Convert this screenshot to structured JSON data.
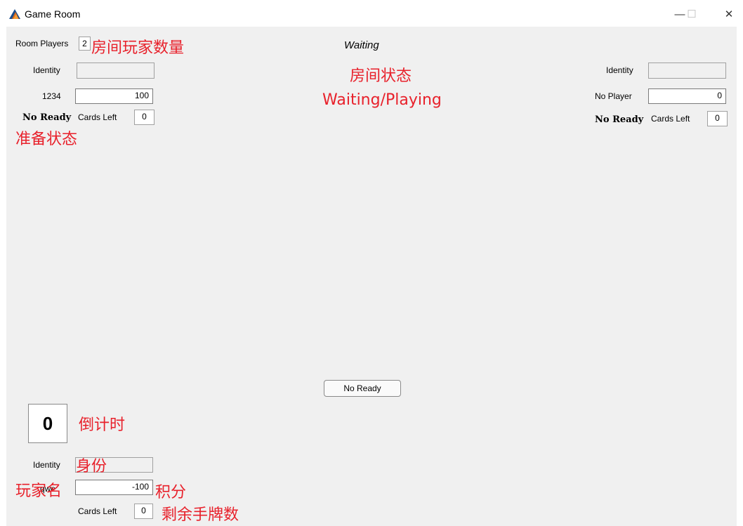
{
  "window": {
    "title": "Game Room",
    "icon": "matlab-icon",
    "controls": {
      "minimize": "—",
      "maximize": "☐",
      "close": "✕"
    }
  },
  "room": {
    "players_label": "Room Players",
    "players_value": "2",
    "status": "Waiting"
  },
  "left_player": {
    "identity_label": "Identity",
    "identity_value": "",
    "name": "1234",
    "score": "100",
    "ready_status": "No Ready",
    "cards_left_label": "Cards Left",
    "cards_left": "0"
  },
  "right_player": {
    "identity_label": "Identity",
    "identity_value": "",
    "name": "No Player",
    "score": "0",
    "ready_status": "No Ready",
    "cards_left_label": "Cards Left",
    "cards_left": "0"
  },
  "self_player": {
    "countdown": "0",
    "identity_label": "Identity",
    "identity_value": "",
    "name": "qwe",
    "score": "-100",
    "cards_left_label": "Cards Left",
    "cards_left": "0"
  },
  "ready_button": {
    "label": "No Ready"
  },
  "annotations": {
    "room_players": "房间玩家数量",
    "room_status": "房间状态",
    "room_status_values": "Waiting/Playing",
    "ready_status": "准备状态",
    "countdown": "倒计时",
    "identity": "身份",
    "player_name": "玩家名",
    "score": "积分",
    "cards_left": "剩余手牌数"
  },
  "colors": {
    "annotation": "#e8212b",
    "background": "#f0f0f0"
  }
}
